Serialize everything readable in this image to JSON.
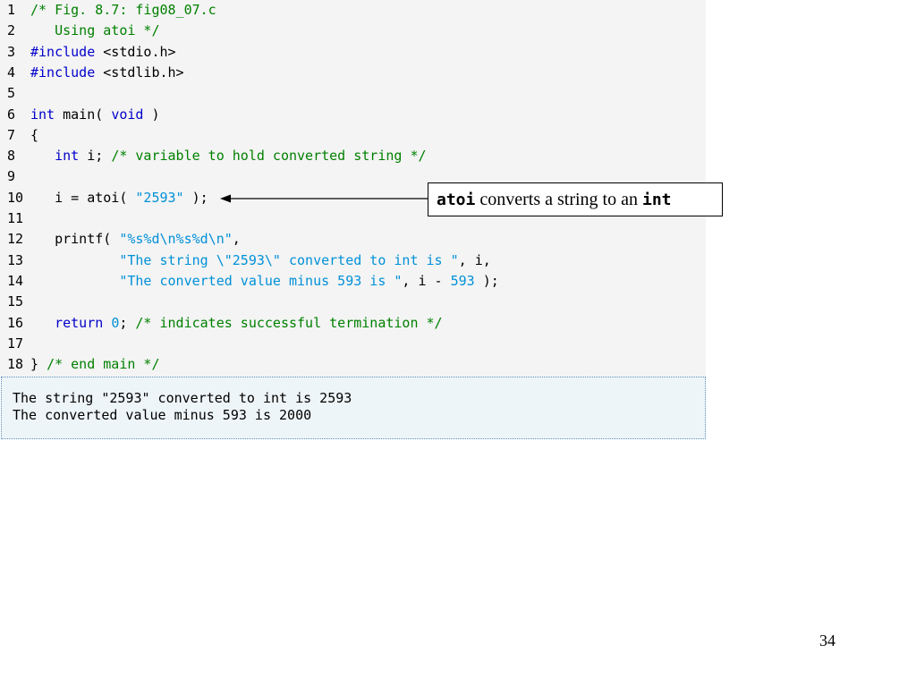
{
  "code": {
    "lines": [
      {
        "num": "1",
        "tokens": [
          {
            "t": "comment",
            "s": "/* Fig. 8.7: fig08_07.c"
          }
        ]
      },
      {
        "num": "2",
        "tokens": [
          {
            "t": "comment",
            "s": "   Using atoi */"
          }
        ]
      },
      {
        "num": "3",
        "tokens": [
          {
            "t": "keyword",
            "s": "#include"
          },
          {
            "t": "plain",
            "s": " <stdio.h>"
          }
        ]
      },
      {
        "num": "4",
        "tokens": [
          {
            "t": "keyword",
            "s": "#include"
          },
          {
            "t": "plain",
            "s": " <stdlib.h>"
          }
        ]
      },
      {
        "num": "5",
        "tokens": []
      },
      {
        "num": "6",
        "tokens": [
          {
            "t": "keyword",
            "s": "int"
          },
          {
            "t": "plain",
            "s": " main( "
          },
          {
            "t": "keyword",
            "s": "void"
          },
          {
            "t": "plain",
            "s": " )"
          }
        ]
      },
      {
        "num": "7",
        "tokens": [
          {
            "t": "plain",
            "s": "{"
          }
        ]
      },
      {
        "num": "8",
        "tokens": [
          {
            "t": "plain",
            "s": "   "
          },
          {
            "t": "keyword",
            "s": "int"
          },
          {
            "t": "plain",
            "s": " i; "
          },
          {
            "t": "comment",
            "s": "/* variable to hold converted string */"
          }
        ]
      },
      {
        "num": "9",
        "tokens": []
      },
      {
        "num": "10",
        "tokens": [
          {
            "t": "plain",
            "s": "   i = atoi( "
          },
          {
            "t": "string",
            "s": "\"2593\""
          },
          {
            "t": "plain",
            "s": " );"
          }
        ]
      },
      {
        "num": "11",
        "tokens": []
      },
      {
        "num": "12",
        "tokens": [
          {
            "t": "plain",
            "s": "   printf( "
          },
          {
            "t": "string",
            "s": "\"%s%d\\n%s%d\\n\""
          },
          {
            "t": "plain",
            "s": ","
          }
        ]
      },
      {
        "num": "13",
        "tokens": [
          {
            "t": "plain",
            "s": "           "
          },
          {
            "t": "string",
            "s": "\"The string \\\"2593\\\" converted to int is \""
          },
          {
            "t": "plain",
            "s": ", i,"
          }
        ]
      },
      {
        "num": "14",
        "tokens": [
          {
            "t": "plain",
            "s": "           "
          },
          {
            "t": "string",
            "s": "\"The converted value minus 593 is \""
          },
          {
            "t": "plain",
            "s": ", i - "
          },
          {
            "t": "number",
            "s": "593"
          },
          {
            "t": "plain",
            "s": " );"
          }
        ]
      },
      {
        "num": "15",
        "tokens": []
      },
      {
        "num": "16",
        "tokens": [
          {
            "t": "plain",
            "s": "   "
          },
          {
            "t": "keyword",
            "s": "return"
          },
          {
            "t": "plain",
            "s": " "
          },
          {
            "t": "number",
            "s": "0"
          },
          {
            "t": "plain",
            "s": "; "
          },
          {
            "t": "comment",
            "s": "/* indicates successful termination */"
          }
        ]
      },
      {
        "num": "17",
        "tokens": []
      },
      {
        "num": "18",
        "tokens": [
          {
            "t": "plain",
            "s": "} "
          },
          {
            "t": "comment",
            "s": "/* end main */"
          }
        ]
      }
    ]
  },
  "callout": {
    "code_word": "atoi",
    "text": " converts a string to an ",
    "code_word2": "int"
  },
  "output": {
    "lines": [
      "The string \"2593\" converted to int is 2593",
      "The converted value minus 593 is 2000"
    ]
  },
  "page_number": "34",
  "colors": {
    "code_background": "#f4f4f4",
    "output_background": "#eef5f8",
    "comment": "#008000",
    "keyword": "#0000cc",
    "string": "#0090d8"
  }
}
